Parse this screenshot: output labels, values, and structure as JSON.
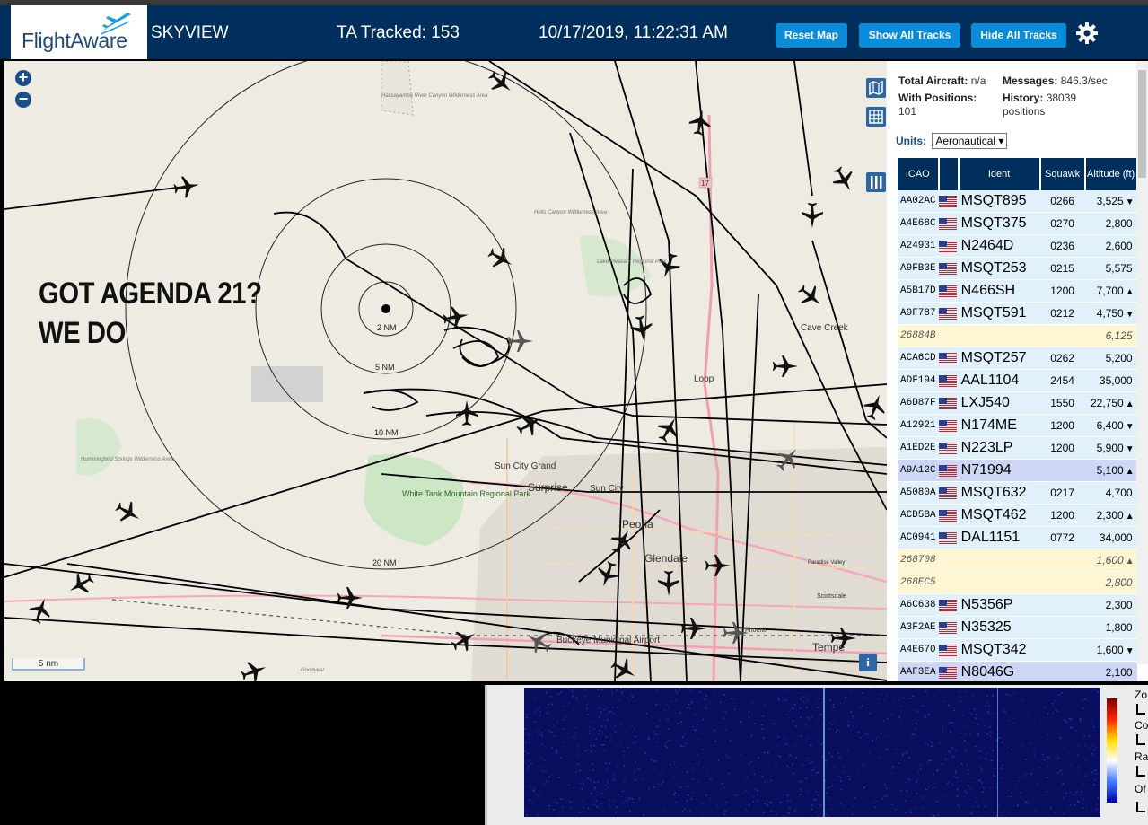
{
  "header": {
    "logo_text": "FlightAware",
    "app_title": "SKYVIEW",
    "tracked": "TA Tracked: 153",
    "datetime": "10/17/2019, 11:22:31 AM",
    "buttons": {
      "reset": "Reset Map",
      "show_all": "Show All Tracks",
      "hide_all": "Hide All Tracks"
    }
  },
  "map": {
    "meme_line1": "GOT AGENDA 21?",
    "meme_line2": "WE DO",
    "zoom_in": "+",
    "zoom_out": "−",
    "scale": "5 nm",
    "info": "i",
    "rings": [
      "2 NM",
      "5 NM",
      "10 NM",
      "20 NM"
    ],
    "places": [
      "Hassayampa River Canyon Wilderness Area",
      "Hells Canyon Wilderness Area",
      "Lake Pleasant Regional Park",
      "Cave Creek",
      "Sun City Grand",
      "Surprise",
      "Sun City",
      "Peoria",
      "Glendale",
      "White Tank Mountain Regional Park",
      "Hummingbird Springs Wilderness Area",
      "Scottsdale",
      "Paradise Valley",
      "Tempe",
      "Goodyear",
      "Buckeye Municipal Airport",
      "Phoenix",
      "Loop"
    ],
    "highway_17": "17"
  },
  "sidebar": {
    "total_aircraft_label": "Total Aircraft:",
    "total_aircraft_value": "n/a",
    "messages_label": "Messages:",
    "messages_value": "846.3/sec",
    "with_positions_label": "With Positions:",
    "with_positions_value": "101",
    "history_label": "History:",
    "history_value": "38039",
    "history_unit": "positions",
    "units_label": "Units:",
    "units_value": "Aeronautical",
    "columns": {
      "icao": "ICAO",
      "ident": "Ident",
      "squawk": "Squawk",
      "altitude": "Altitude (ft)"
    },
    "rows": [
      {
        "icao": "AA02AC",
        "ident": "MSQT895",
        "squawk": "0266",
        "alt": "3,525",
        "trend": "▼",
        "kind": "normal",
        "flag": true
      },
      {
        "icao": "A4E68C",
        "ident": "MSQT375",
        "squawk": "0270",
        "alt": "2,800",
        "trend": "",
        "kind": "normal",
        "flag": true
      },
      {
        "icao": "A24931",
        "ident": "N2464D",
        "squawk": "0236",
        "alt": "2,600",
        "trend": "",
        "kind": "normal",
        "flag": true
      },
      {
        "icao": "A9FB3E",
        "ident": "MSQT253",
        "squawk": "0215",
        "alt": "5,575",
        "trend": "",
        "kind": "normal",
        "flag": true
      },
      {
        "icao": "A5B17D",
        "ident": "N466SH",
        "squawk": "1200",
        "alt": "7,700",
        "trend": "▲",
        "kind": "normal",
        "flag": true
      },
      {
        "icao": "A9F787",
        "ident": "MSQT591",
        "squawk": "0212",
        "alt": "4,750",
        "trend": "▼",
        "kind": "normal",
        "flag": true
      },
      {
        "icao": "26884B",
        "ident": "",
        "squawk": "",
        "alt": "6,125",
        "trend": "",
        "kind": "alt",
        "flag": false
      },
      {
        "icao": "ACA6CD",
        "ident": "MSQT257",
        "squawk": "0262",
        "alt": "5,200",
        "trend": "",
        "kind": "normal",
        "flag": true
      },
      {
        "icao": "ADF194",
        "ident": "AAL1104",
        "squawk": "2454",
        "alt": "35,000",
        "trend": "",
        "kind": "normal",
        "flag": true
      },
      {
        "icao": "A6D87F",
        "ident": "LXJ540",
        "squawk": "1550",
        "alt": "22,750",
        "trend": "▲",
        "kind": "normal",
        "flag": true
      },
      {
        "icao": "A12921",
        "ident": "N174ME",
        "squawk": "1200",
        "alt": "6,400",
        "trend": "▼",
        "kind": "normal",
        "flag": true
      },
      {
        "icao": "A1ED2E",
        "ident": "N223LP",
        "squawk": "1200",
        "alt": "5,900",
        "trend": "▼",
        "kind": "normal",
        "flag": true
      },
      {
        "icao": "A9A12C",
        "ident": "N71994",
        "squawk": "",
        "alt": "5,100",
        "trend": "▲",
        "kind": "sel",
        "flag": true
      },
      {
        "icao": "A5080A",
        "ident": "MSQT632",
        "squawk": "0217",
        "alt": "4,700",
        "trend": "",
        "kind": "normal",
        "flag": true
      },
      {
        "icao": "ACD5BA",
        "ident": "MSQT462",
        "squawk": "1200",
        "alt": "2,300",
        "trend": "▲",
        "kind": "normal",
        "flag": true
      },
      {
        "icao": "AC0941",
        "ident": "DAL1151",
        "squawk": "0772",
        "alt": "34,000",
        "trend": "",
        "kind": "normal",
        "flag": true
      },
      {
        "icao": "268708",
        "ident": "",
        "squawk": "",
        "alt": "1,600",
        "trend": "▲",
        "kind": "alt",
        "flag": false
      },
      {
        "icao": "268EC5",
        "ident": "",
        "squawk": "",
        "alt": "2,800",
        "trend": "",
        "kind": "alt",
        "flag": false
      },
      {
        "icao": "A6C638",
        "ident": "N5356P",
        "squawk": "",
        "alt": "2,300",
        "trend": "",
        "kind": "normal",
        "flag": true
      },
      {
        "icao": "A3F2AE",
        "ident": "N35325",
        "squawk": "",
        "alt": "1,800",
        "trend": "",
        "kind": "normal",
        "flag": true
      },
      {
        "icao": "A4E670",
        "ident": "MSQT342",
        "squawk": "",
        "alt": "1,600",
        "trend": "▼",
        "kind": "normal",
        "flag": true
      },
      {
        "icao": "AAF3EA",
        "ident": "N8046G",
        "squawk": "",
        "alt": "2,100",
        "trend": "",
        "kind": "sel",
        "flag": true
      }
    ]
  },
  "spectrum": {
    "labels": [
      "Zo",
      "Co",
      "Ra",
      "Of"
    ]
  },
  "colors": {
    "header_bg": "#002f5d",
    "button_bg": "#0b8cd9",
    "row_normal": "#e1f1fb",
    "row_alt": "#fef5d3",
    "row_selected": "#cdd6f5"
  }
}
